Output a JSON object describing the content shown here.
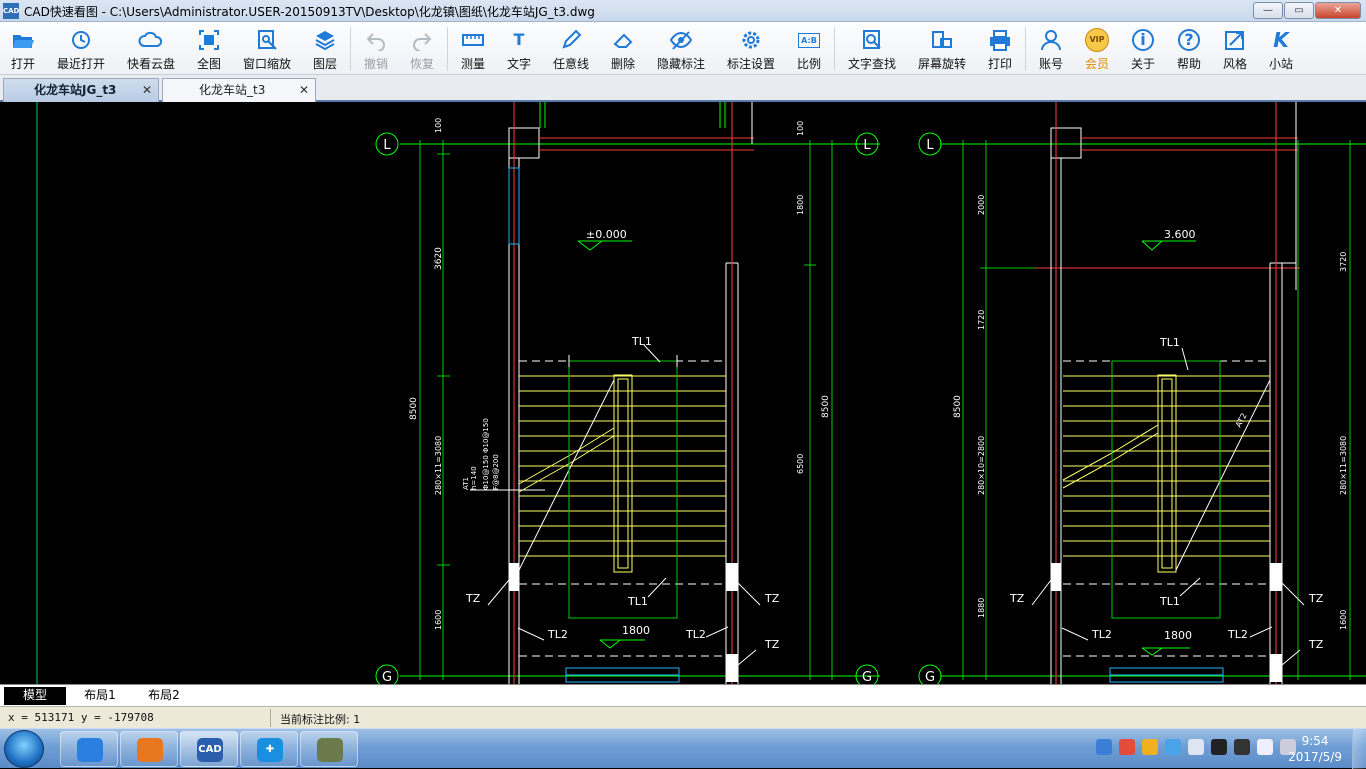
{
  "window": {
    "app_icon_text": "CAD",
    "title": "CAD快速看图 - C:\\Users\\Administrator.USER-20150913TV\\Desktop\\化龙镇\\图纸\\化龙车站JG_t3.dwg",
    "min": "—",
    "max": "▭",
    "close": "✕"
  },
  "toolbar": [
    {
      "label": "打开",
      "icon": "folder-open-icon",
      "enabled": true
    },
    {
      "label": "最近打开",
      "icon": "history-icon",
      "enabled": true
    },
    {
      "label": "快看云盘",
      "icon": "cloud-icon",
      "enabled": true
    },
    {
      "label": "全图",
      "icon": "fit-all-icon",
      "enabled": true
    },
    {
      "label": "窗口缩放",
      "icon": "zoom-window-icon",
      "enabled": true
    },
    {
      "label": "图层",
      "icon": "layers-icon",
      "enabled": true
    },
    {
      "label": "撤销",
      "icon": "undo-icon",
      "enabled": false
    },
    {
      "label": "恢复",
      "icon": "redo-icon",
      "enabled": false
    },
    {
      "label": "测量",
      "icon": "measure-icon",
      "enabled": true
    },
    {
      "label": "文字",
      "icon": "text-icon",
      "enabled": true
    },
    {
      "label": "任意线",
      "icon": "pen-icon",
      "enabled": true
    },
    {
      "label": "删除",
      "icon": "eraser-icon",
      "enabled": true
    },
    {
      "label": "隐藏标注",
      "icon": "hide-eye-icon",
      "enabled": true
    },
    {
      "label": "标注设置",
      "icon": "gear-icon",
      "enabled": true
    },
    {
      "label": "比例",
      "icon": "scale-icon",
      "enabled": true
    },
    {
      "label": "文字查找",
      "icon": "text-search-icon",
      "enabled": true
    },
    {
      "label": "屏幕旋转",
      "icon": "rotate-icon",
      "enabled": true
    },
    {
      "label": "打印",
      "icon": "printer-icon",
      "enabled": true
    },
    {
      "label": "账号",
      "icon": "user-icon",
      "enabled": true
    },
    {
      "label": "会员",
      "icon": "vip-icon",
      "enabled": true
    },
    {
      "label": "关于",
      "icon": "info-icon",
      "enabled": true
    },
    {
      "label": "帮助",
      "icon": "help-icon",
      "enabled": true
    },
    {
      "label": "风格",
      "icon": "style-icon",
      "enabled": true
    },
    {
      "label": "小站",
      "icon": "k-logo-icon",
      "enabled": true
    }
  ],
  "icon_glyphs": {
    "vip": "VIP",
    "text": "T",
    "info": "i",
    "help": "?",
    "k_logo": "K",
    "scale": "A:B"
  },
  "doc_tabs": [
    {
      "label": "化龙车站JG_t3",
      "active": true,
      "close": "✕"
    },
    {
      "label": "化龙车站_t3",
      "active": false,
      "close": "✕"
    }
  ],
  "drawing": {
    "left_plan": {
      "axis_top": "L",
      "axis_bottom": "G",
      "level": "±0.000",
      "beam_top": "TL1",
      "beam_bottom": "TL1",
      "beam_tl2_left": "TL2",
      "beam_tl2_right": "TL2",
      "tz_left": "TZ",
      "tz_right": "TZ",
      "tz_right2": "TZ",
      "landing_width": "1800",
      "dim_left_top": "100",
      "dim_left_mid": "3620",
      "dim_left_total": "8500",
      "dim_left_run": "280×11=3080",
      "dim_left_bottom": "1600",
      "dim_right_top": "100",
      "dim_right_a": "1800",
      "dim_right_b": "6500",
      "dim_right_total": "8500",
      "slab_note_1": "AT1",
      "slab_note_2": "h=140",
      "slab_note_3": "Φ10@150 Φ10@150",
      "slab_note_4": "F@8@200"
    },
    "right_plan": {
      "axis_top": "L",
      "axis_bottom": "G",
      "axis_left_bottom": "G",
      "level": "3.600",
      "beam_top": "TL1",
      "beam_bottom": "TL1",
      "beam_tl2_left": "TL2",
      "beam_tl2_right": "TL2",
      "tz_left": "TZ",
      "tz_right": "TZ",
      "tz_right2": "TZ",
      "slab": "AT2",
      "landing_width": "1800",
      "dim_left_top": "2000",
      "dim_left_mid": "1720",
      "dim_left_total": "8500",
      "dim_left_run": "280×10=2800",
      "dim_left_bottom": "1880",
      "dim_right_top": "3720",
      "dim_right_run": "280×11=3080",
      "dim_right_bottom": "1600"
    },
    "colors": {
      "axis": "#00ff00",
      "wall": "#ff3b3b",
      "stair": "#ffff66",
      "text": "#ffffff",
      "dim": "#00cc00",
      "hatch": "#1fb3ff"
    }
  },
  "layout_tabs": [
    "模型",
    "布局1",
    "布局2"
  ],
  "status": {
    "coords": "x = 513171 y = -179708",
    "scale": "当前标注比例: 1"
  },
  "taskbar": {
    "apps": [
      {
        "name": "chrome-app",
        "color": "#2a7fe0",
        "glyph": ""
      },
      {
        "name": "browser-app",
        "color": "#e8771f",
        "glyph": ""
      },
      {
        "name": "cad-app",
        "color": "#2b5fae",
        "glyph": "CAD"
      },
      {
        "name": "transfer-app",
        "color": "#1a8ee0",
        "glyph": "✚"
      },
      {
        "name": "photo-app",
        "color": "#6b7a4a",
        "glyph": ""
      }
    ],
    "time": "9:54",
    "date": "2017/5/9"
  }
}
